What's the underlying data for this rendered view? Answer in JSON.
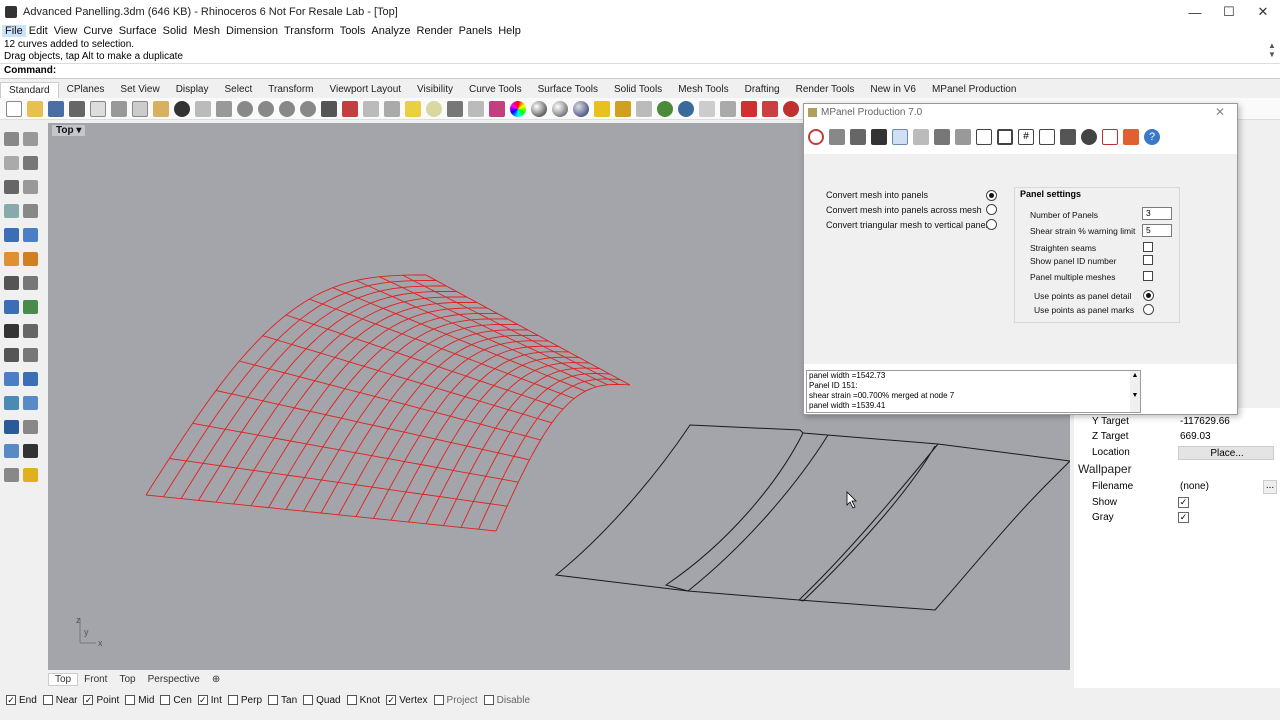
{
  "window": {
    "title": "Advanced Panelling.3dm (646 KB) - Rhinoceros 6 Not For Resale Lab - [Top]",
    "minimize": "—",
    "maximize": "☐",
    "close": "✕"
  },
  "menu": [
    "File",
    "Edit",
    "View",
    "Curve",
    "Surface",
    "Solid",
    "Mesh",
    "Dimension",
    "Transform",
    "Tools",
    "Analyze",
    "Render",
    "Panels",
    "Help"
  ],
  "command": {
    "history": [
      "12 curves added to selection.",
      "Drag objects, tap Alt to make a duplicate"
    ],
    "prompt": "Command:"
  },
  "toolbar_tabs": [
    "Standard",
    "CPlanes",
    "Set View",
    "Display",
    "Select",
    "Transform",
    "Viewport Layout",
    "Visibility",
    "Curve Tools",
    "Surface Tools",
    "Solid Tools",
    "Mesh Tools",
    "Drafting",
    "Render Tools",
    "New in V6",
    "MPanel Production"
  ],
  "viewport": {
    "title": "Top",
    "dropdown": "▾",
    "axis_y": "y",
    "axis_x": "x",
    "axis_z": "z"
  },
  "viewport_tabs": [
    "Top",
    "Front",
    "Top",
    "Perspective",
    "⊕"
  ],
  "osnaps": [
    {
      "label": "End",
      "checked": true
    },
    {
      "label": "Near",
      "checked": false
    },
    {
      "label": "Point",
      "checked": true
    },
    {
      "label": "Mid",
      "checked": false
    },
    {
      "label": "Cen",
      "checked": false
    },
    {
      "label": "Int",
      "checked": true
    },
    {
      "label": "Perp",
      "checked": false
    },
    {
      "label": "Tan",
      "checked": false
    },
    {
      "label": "Quad",
      "checked": false
    },
    {
      "label": "Knot",
      "checked": false
    },
    {
      "label": "Vertex",
      "checked": true
    },
    {
      "label": "Project",
      "checked": false
    },
    {
      "label": "Disable",
      "checked": false
    }
  ],
  "properties": {
    "y_target_label": "Y Target",
    "y_target_value": "-117629.66",
    "z_target_label": "Z Target",
    "z_target_value": "669.03",
    "location_label": "Location",
    "location_button": "Place...",
    "wallpaper_title": "Wallpaper",
    "filename_label": "Filename",
    "filename_value": "(none)",
    "filename_browse": "...",
    "show_label": "Show",
    "gray_label": "Gray"
  },
  "mpanel": {
    "title": "MPanel Production 7.0",
    "close": "✕",
    "options": [
      "Convert mesh into panels",
      "Convert mesh into panels across mesh",
      "Convert triangular mesh to vertical panels"
    ],
    "selected_option": 0,
    "settings_title": "Panel settings",
    "number_of_panels_label": "Number of  Panels",
    "number_of_panels_value": "3",
    "shear_strain_label": "Shear strain % warning limit",
    "shear_strain_value": "5",
    "straighten_seams_label": "Straighten seams",
    "show_panel_id_label": "Show panel ID number",
    "panel_multiple_meshes_label": "Panel multiple meshes",
    "points_detail_label": "Use points as panel detail",
    "points_marks_label": "Use points as panel marks",
    "log": [
      "panel width =1542.73",
      "Panel ID 151:",
      "shear strain =00.700% merged at node 7",
      "panel width =1539.41"
    ]
  },
  "colors": {
    "mesh_red": "#e02020",
    "panel_outline": "#1a1a1a",
    "viewport_bg": "#a3a5aa"
  }
}
